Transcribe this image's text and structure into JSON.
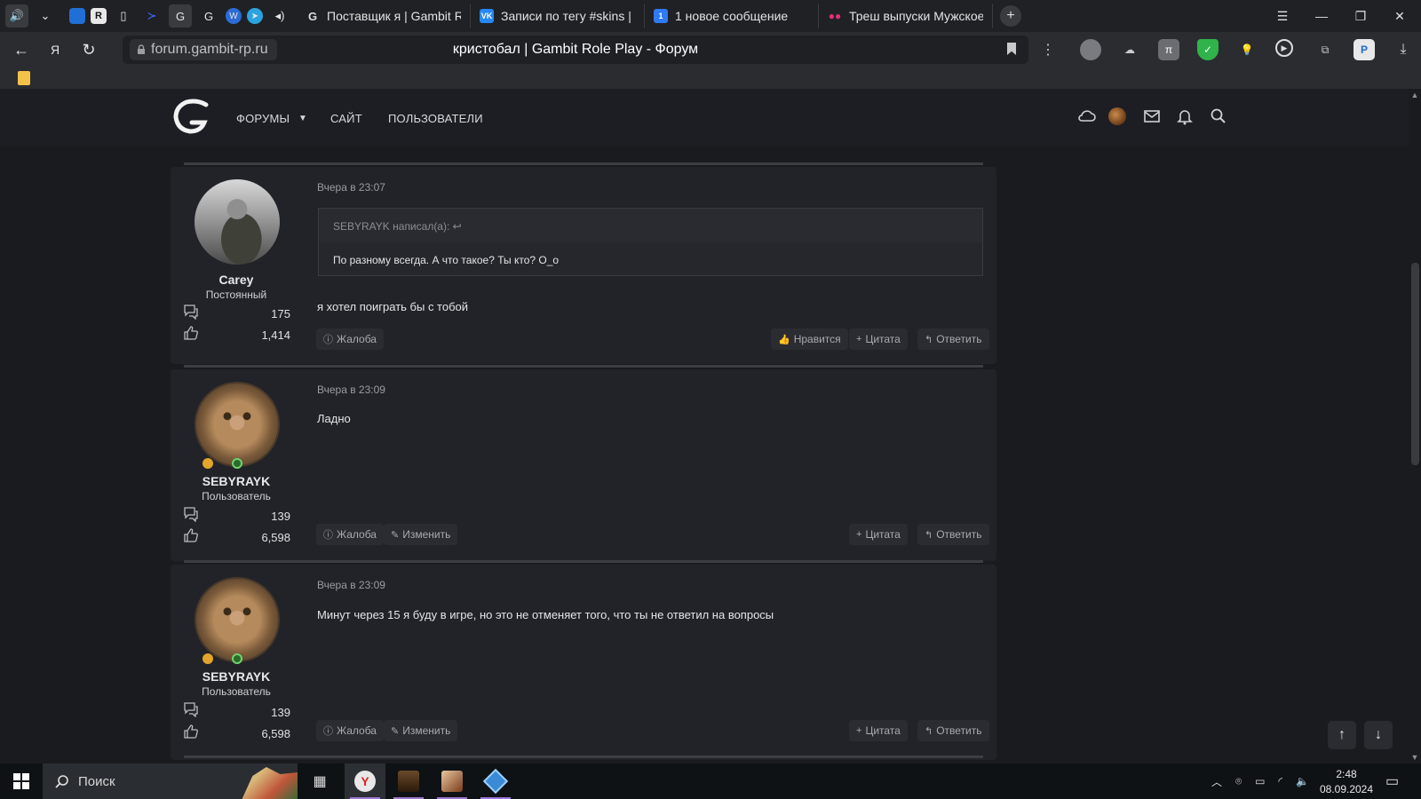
{
  "browser": {
    "tabs": [
      {
        "label": "Поставщик я | Gambit Rol",
        "favicon": "gambit-logo-icon"
      },
      {
        "label": "Записи по тегу #skins | bl",
        "favicon": "vk-icon"
      },
      {
        "label": "1 новое сообщение",
        "favicon": "message-icon"
      },
      {
        "label": "Треш выпуски Мужское Ж",
        "favicon": "video-icon"
      }
    ],
    "new_tab_label": "+",
    "domain": "forum.gambit-rp.ru",
    "page_title": "кристобал | Gambit Role Play - Форум"
  },
  "site": {
    "nav": [
      {
        "label": "ФОРУМЫ"
      },
      {
        "label": "САЙТ"
      },
      {
        "label": "ПОЛЬЗОВАТЕЛИ"
      }
    ],
    "accent": "#3d3e44"
  },
  "posts": [
    {
      "author": "Carey",
      "user_title": "Постоянный",
      "messages_count": "175",
      "reactions_count": "1,414",
      "time": "Вчера в 23:07",
      "quote": {
        "header": "SEBYRAYK написал(а):",
        "text": "По разному всегда. А что такое? Ты кто? О_о"
      },
      "text": "я хотел поиграть бы с тобой",
      "actions_left": [
        "Жалоба"
      ],
      "actions_right": [
        "Нравится",
        "Цитата",
        "Ответить"
      ]
    },
    {
      "author": "SEBYRAYK",
      "user_title": "Пользователь",
      "messages_count": "139",
      "reactions_count": "6,598",
      "time": "Вчера в 23:09",
      "text": "Ладно",
      "actions_left": [
        "Жалоба",
        "Изменить"
      ],
      "actions_right": [
        "Цитата",
        "Ответить"
      ]
    },
    {
      "author": "SEBYRAYK",
      "user_title": "Пользователь",
      "messages_count": "139",
      "reactions_count": "6,598",
      "time": "Вчера в 23:09",
      "text": "Минут через 15 я буду в игре, но это не отменяет того, что ты не ответил на вопросы",
      "actions_left": [
        "Жалоба",
        "Изменить"
      ],
      "actions_right": [
        "Цитата",
        "Ответить"
      ]
    }
  ],
  "taskbar": {
    "search_placeholder": "Поиск",
    "time": "2:48",
    "date": "08.09.2024"
  }
}
